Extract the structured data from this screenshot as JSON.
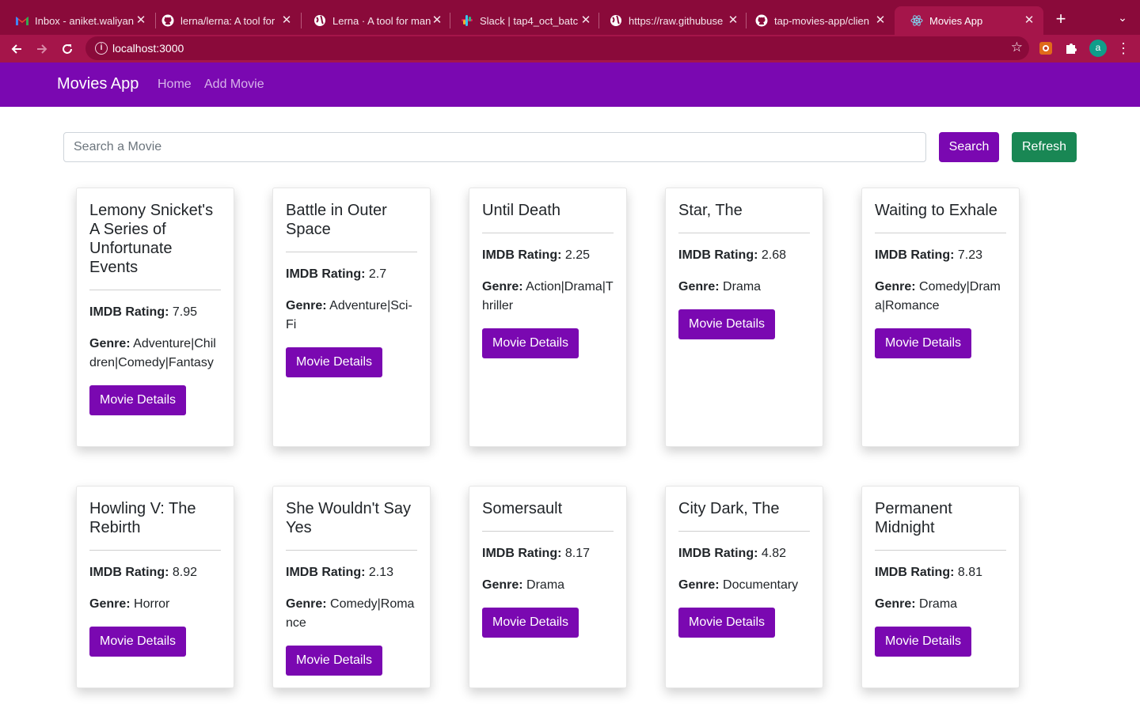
{
  "browser": {
    "tabs": [
      {
        "title": "Inbox - aniket.waliyan",
        "icon": "gmail-icon",
        "active": false
      },
      {
        "title": "lerna/lerna: A tool for",
        "icon": "github-icon",
        "active": false
      },
      {
        "title": "Lerna · A tool for man",
        "icon": "globe-icon",
        "active": false
      },
      {
        "title": "Slack | tap4_oct_batc",
        "icon": "slack-icon",
        "active": false
      },
      {
        "title": "https://raw.githubuse",
        "icon": "globe-icon",
        "active": false
      },
      {
        "title": "tap-movies-app/clien",
        "icon": "github-icon",
        "active": false
      },
      {
        "title": "Movies App",
        "icon": "react-icon",
        "active": true
      }
    ],
    "url": "localhost:3000",
    "profile_initial": "a",
    "colors": {
      "tabstrip": "#8a0a3a",
      "toolbar": "#a5154a"
    }
  },
  "navbar": {
    "brand": "Movies App",
    "links": [
      "Home",
      "Add Movie"
    ],
    "color": "#7a08b1"
  },
  "search": {
    "placeholder": "Search a Movie",
    "value": "",
    "search_label": "Search",
    "refresh_label": "Refresh"
  },
  "labels": {
    "rating": "IMDB Rating:",
    "genre": "Genre:",
    "details_button": "Movie Details"
  },
  "movies": [
    {
      "title": "Lemony Snicket's A Series of Unfortunate Events",
      "rating": "7.95",
      "genre": "Adventure|Children|Comedy|Fantasy"
    },
    {
      "title": "Battle in Outer Space",
      "rating": "2.7",
      "genre": "Adventure|Sci-Fi"
    },
    {
      "title": "Until Death",
      "rating": "2.25",
      "genre": "Action|Drama|Thriller"
    },
    {
      "title": "Star, The",
      "rating": "2.68",
      "genre": "Drama"
    },
    {
      "title": "Waiting to Exhale",
      "rating": "7.23",
      "genre": "Comedy|Drama|Romance"
    },
    {
      "title": "Howling V: The Rebirth",
      "rating": "8.92",
      "genre": "Horror"
    },
    {
      "title": "She Wouldn't Say Yes",
      "rating": "2.13",
      "genre": "Comedy|Romance"
    },
    {
      "title": "Somersault",
      "rating": "8.17",
      "genre": "Drama"
    },
    {
      "title": "City Dark, The",
      "rating": "4.82",
      "genre": "Documentary"
    },
    {
      "title": "Permanent Midnight",
      "rating": "8.81",
      "genre": "Drama"
    }
  ]
}
